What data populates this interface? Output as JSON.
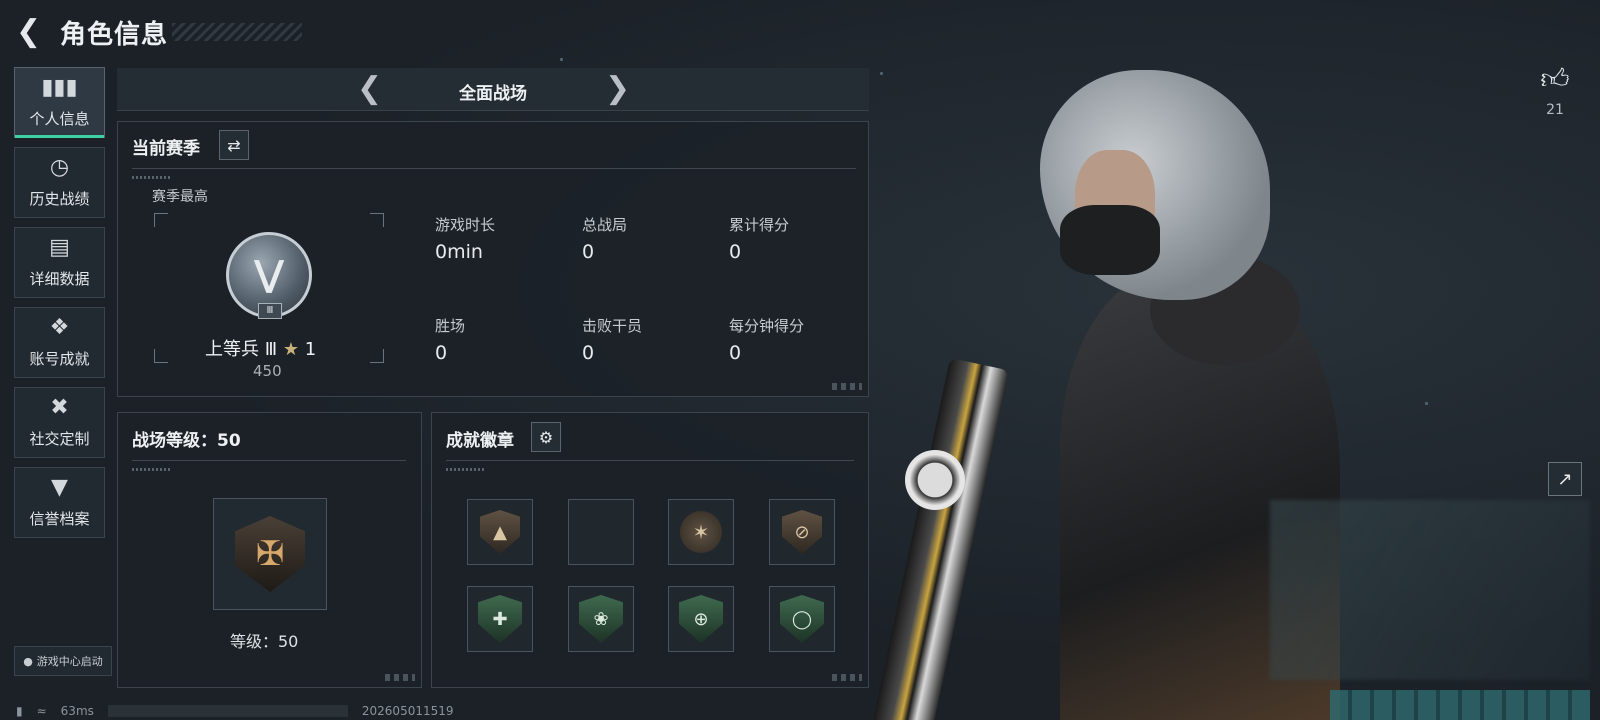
{
  "header": {
    "title": "角色信息"
  },
  "sidebar": {
    "items": [
      {
        "label": "个人信息",
        "icon": "bar-chart-icon"
      },
      {
        "label": "历史战绩",
        "icon": "history-icon"
      },
      {
        "label": "详细数据",
        "icon": "folder-icon"
      },
      {
        "label": "账号成就",
        "icon": "achievement-icon"
      },
      {
        "label": "社交定制",
        "icon": "tools-icon"
      },
      {
        "label": "信誉档案",
        "icon": "credit-icon"
      }
    ],
    "launch_label": "游戏中心启动"
  },
  "mode": {
    "title": "全面战场"
  },
  "season": {
    "title": "当前赛季",
    "best_label": "赛季最高",
    "rank_name": "上等兵 Ⅲ",
    "rank_stars": "1",
    "rank_tier": "Ⅲ",
    "rank_score": "450",
    "stats": [
      {
        "label": "游戏时长",
        "value": "0min"
      },
      {
        "label": "总战局",
        "value": "0"
      },
      {
        "label": "累计得分",
        "value": "0"
      },
      {
        "label": "胜场",
        "value": "0"
      },
      {
        "label": "击败干员",
        "value": "0"
      },
      {
        "label": "每分钟得分",
        "value": "0"
      }
    ]
  },
  "level": {
    "title": "战场等级：50",
    "label": "等级：50"
  },
  "badges": {
    "title": "成就徽章"
  },
  "likes": {
    "count": "21"
  },
  "status": {
    "ping": "63ms",
    "build": "202605011519"
  },
  "colors": {
    "accent": "#3dd1a4",
    "background": "#1b2127",
    "panel_border": "#3b444c"
  }
}
